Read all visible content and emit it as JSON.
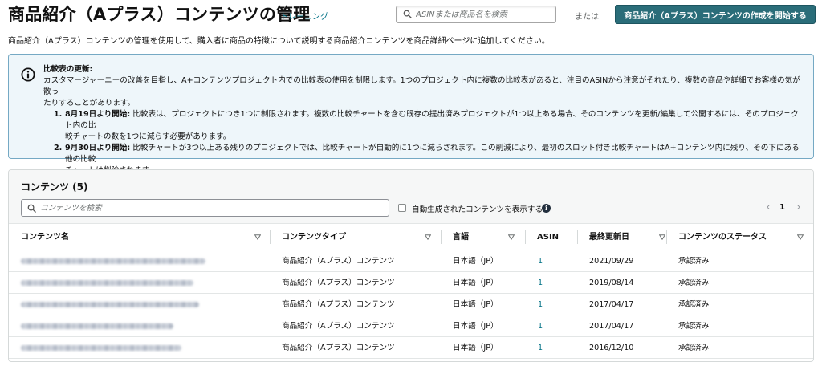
{
  "header": {
    "title": "商品紹介（Aプラス）コンテンツの管理",
    "training_link": "トレーニング",
    "search_placeholder": "ASINまたは商品名を検索",
    "or_text": "または",
    "start_button": "商品紹介（Aプラス）コンテンツの作成を開始する"
  },
  "description": "商品紹介（Aプラス）コンテンツの管理を使用して、購入者に商品の特徴について説明する商品紹介コンテンツを商品詳細ページに追加してください。",
  "alert": {
    "icon": "info-circle-icon",
    "title": "比較表の更新:",
    "line1": "カスタマージャーニーの改善を目指し、A+コンテンツプロジェクト内での比較表の使用を制限します。1つのプロジェクト内に複数の比較表があると、注目のASINから注意がそれたり、複数の商品や詳細でお客様の気が散っ",
    "line2": "たりすることがあります。",
    "items": [
      {
        "num": "1.",
        "heading": "8月19日より開始:",
        "line1": " 比較表は、プロジェクトにつき1つに制限されます。複数の比較チャートを含む既存の提出済みプロジェクトが1つ以上ある場合、そのコンテンツを更新/編集して公開するには、そのプロジェクト内の比",
        "line2": "較チャートの数を1つに減らす必要があります。"
      },
      {
        "num": "2.",
        "heading": "9月30日より開始:",
        "line1": " 比較チャートが3つ以上ある残りのプロジェクトでは、比較チャートが自動的に1つに減らされます。この削減により、最初のスロット付き比較チャートはA+コンテンツ内に残り、その下にある他の比較",
        "line2": "チャートは削除されます。"
      }
    ]
  },
  "content_panel": {
    "title": "コンテンツ (5)",
    "search_placeholder": "コンテンツを検索",
    "auto_generated_label": "自動生成されたコンテンツを表示する",
    "info_glyph": "i",
    "pager_prev": "‹",
    "page_number": "1",
    "pager_next": "›",
    "columns": [
      "コンテンツ名",
      "コンテンツタイプ",
      "言語",
      "ASIN",
      "最終更新日",
      "コンテンツのステータス"
    ],
    "rows": [
      {
        "type": "商品紹介（Aプラス）コンテンツ",
        "language": "日本語（JP）",
        "asin": "1",
        "updated": "2021/09/29",
        "status": "承認済み"
      },
      {
        "type": "商品紹介（Aプラス）コンテンツ",
        "language": "日本語（JP）",
        "asin": "1",
        "updated": "2019/08/14",
        "status": "承認済み"
      },
      {
        "type": "商品紹介（Aプラス）コンテンツ",
        "language": "日本語（JP）",
        "asin": "1",
        "updated": "2017/04/17",
        "status": "承認済み"
      },
      {
        "type": "商品紹介（Aプラス）コンテンツ",
        "language": "日本語（JP）",
        "asin": "1",
        "updated": "2017/04/17",
        "status": "承認済み"
      },
      {
        "type": "商品紹介（Aプラス）コンテンツ",
        "language": "日本語（JP）",
        "asin": "1",
        "updated": "2016/12/10",
        "status": "承認済み"
      }
    ]
  },
  "colors": {
    "link": "#007185",
    "primary_button": "#2a6d79",
    "alert_background": "#eef6fa",
    "alert_border": "#75a9c4"
  }
}
